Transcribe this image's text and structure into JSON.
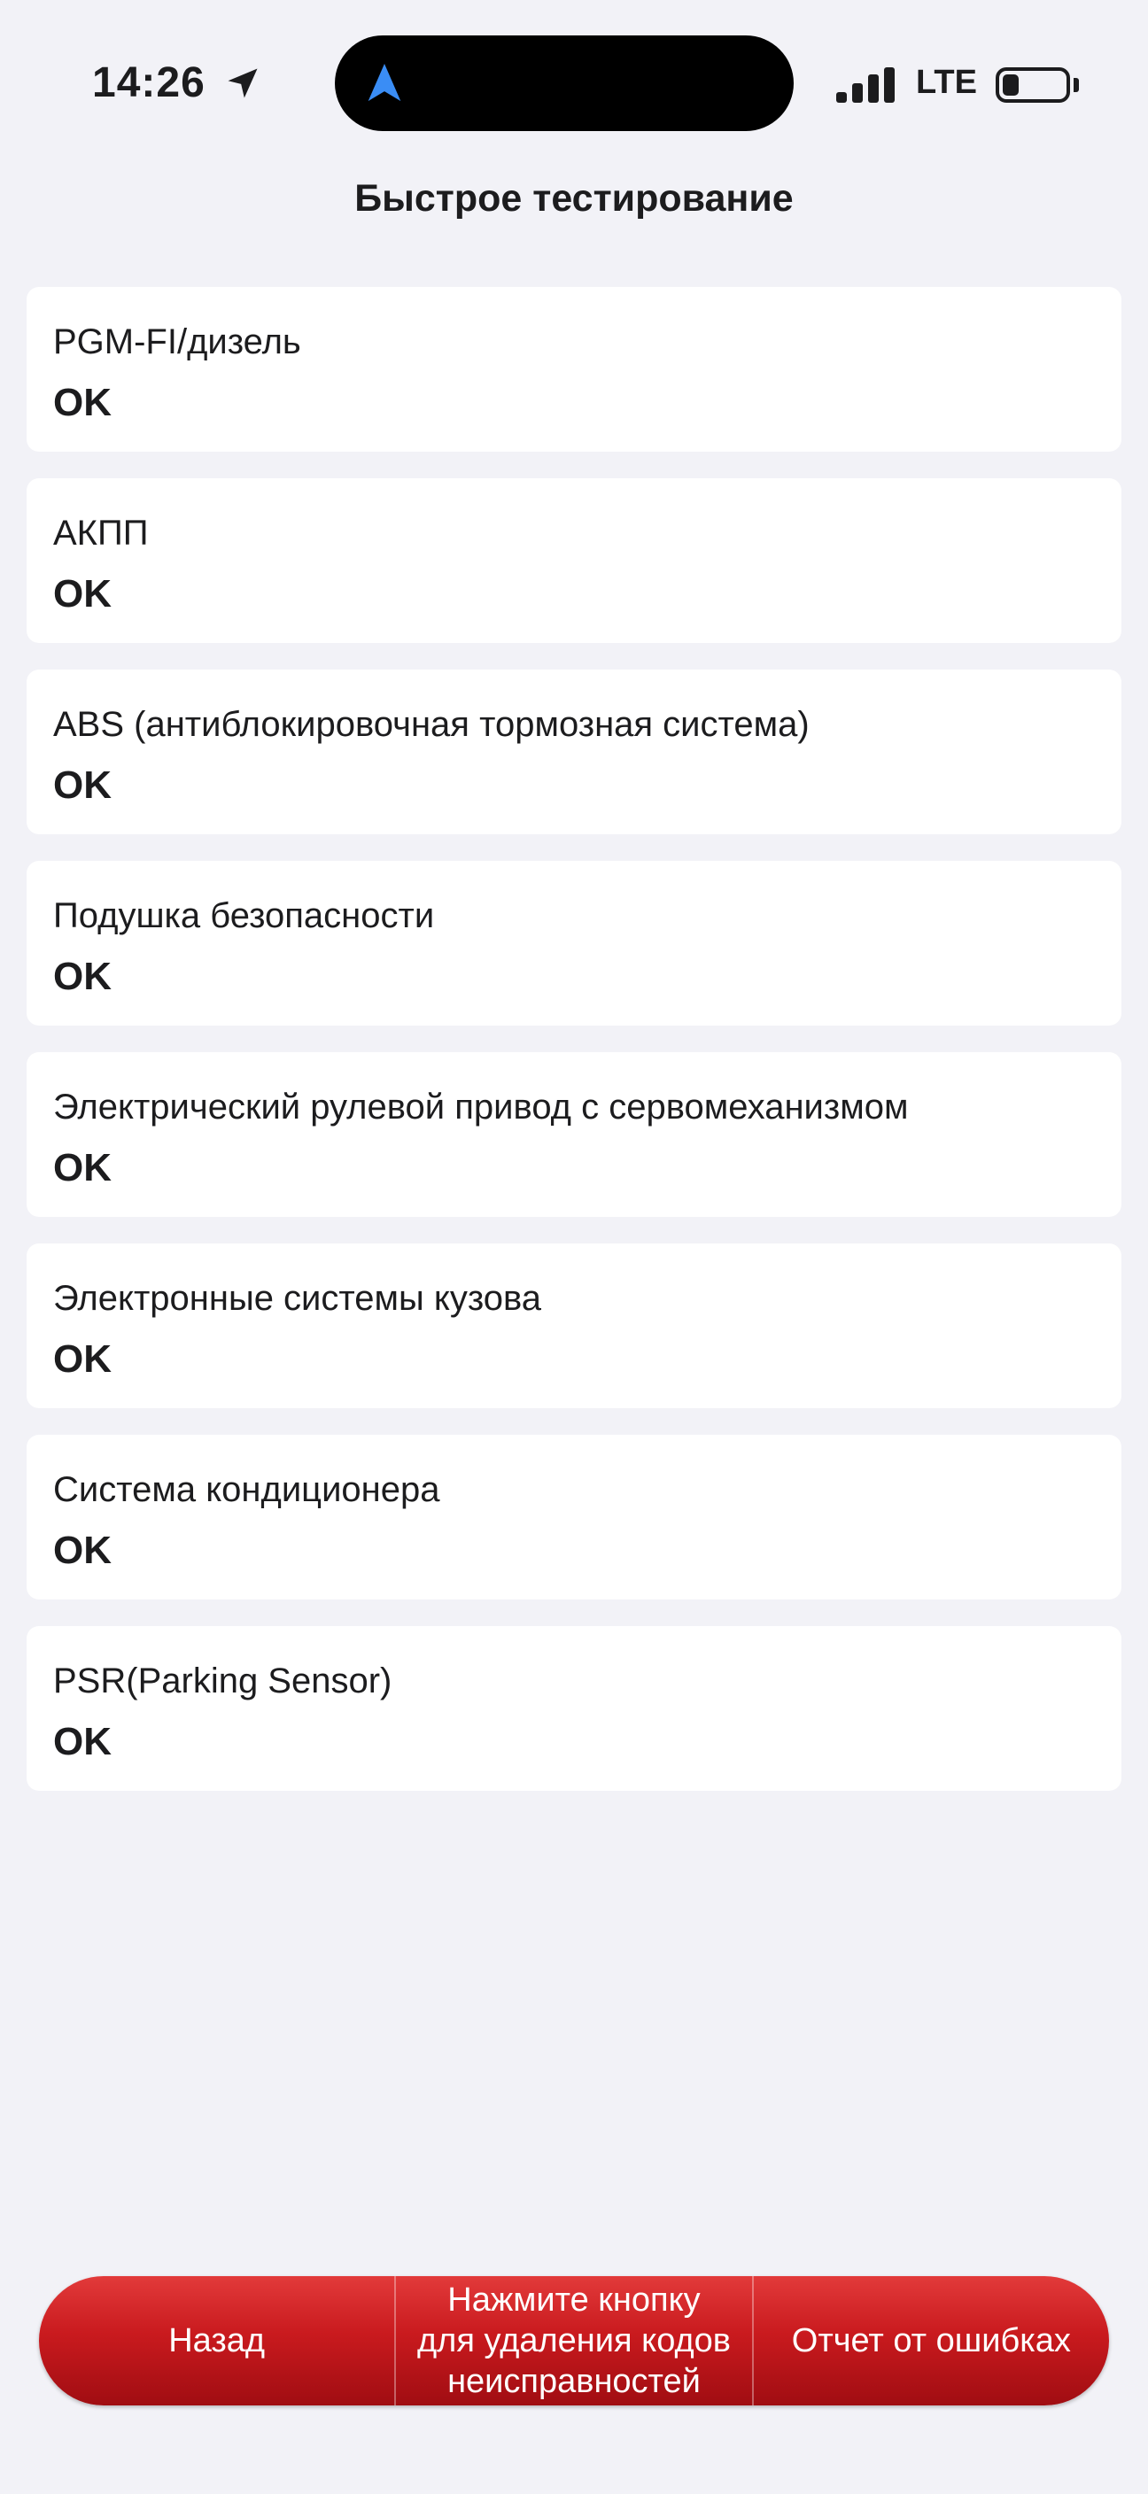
{
  "status_bar": {
    "time": "14:26",
    "network": "LTE",
    "icons": [
      "location-arrow-icon",
      "navigation-arrow-icon",
      "signal-icon",
      "battery-icon"
    ]
  },
  "header": {
    "title": "Быстрое тестирование"
  },
  "systems": [
    {
      "label": "PGM-FI/дизель",
      "status": "OK"
    },
    {
      "label": "АКПП",
      "status": "OK"
    },
    {
      "label": "ABS (антиблокировочная тормозная система)",
      "status": "OK"
    },
    {
      "label": "Подушка безопасности",
      "status": "OK"
    },
    {
      "label": "Электрический рулевой привод с сервомеханизмом",
      "status": "OK"
    },
    {
      "label": "Электронные системы кузова",
      "status": "OK"
    },
    {
      "label": "Система кондиционера",
      "status": "OK"
    },
    {
      "label": "PSR(Parking Sensor)",
      "status": "OK"
    }
  ],
  "footer": {
    "back_label": "Назад",
    "clear_codes_lines": [
      "Нажмите кнопку",
      "для удаления кодов",
      "неисправностей"
    ],
    "report_label": "Отчет от ошибках"
  },
  "colors": {
    "background": "#f2f2f7",
    "card": "#ffffff",
    "button_red": "#c91a1e",
    "island_arrow": "#3a8df5"
  }
}
